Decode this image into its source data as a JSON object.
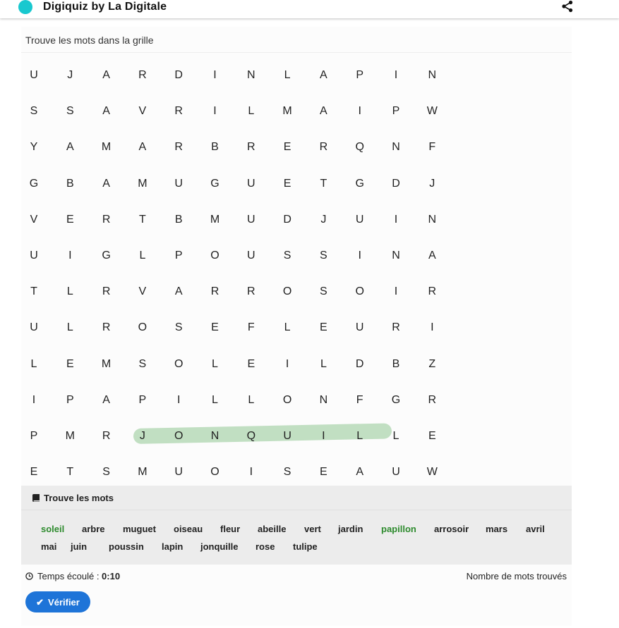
{
  "app": {
    "title": "Digiquiz by La Digitale"
  },
  "prompt": "Trouve les mots dans la grille",
  "grid": [
    [
      "U",
      "J",
      "A",
      "R",
      "D",
      "I",
      "N",
      "L",
      "A",
      "P",
      "I",
      "N"
    ],
    [
      "S",
      "S",
      "A",
      "V",
      "R",
      "I",
      "L",
      "M",
      "A",
      "I",
      "P",
      "W"
    ],
    [
      "Y",
      "A",
      "M",
      "A",
      "R",
      "B",
      "R",
      "E",
      "R",
      "Q",
      "N",
      "F"
    ],
    [
      "G",
      "B",
      "A",
      "M",
      "U",
      "G",
      "U",
      "E",
      "T",
      "G",
      "D",
      "J"
    ],
    [
      "V",
      "E",
      "R",
      "T",
      "B",
      "M",
      "U",
      "D",
      "J",
      "U",
      "I",
      "N"
    ],
    [
      "U",
      "I",
      "G",
      "L",
      "P",
      "O",
      "U",
      "S",
      "S",
      "I",
      "N",
      "A"
    ],
    [
      "T",
      "L",
      "R",
      "V",
      "A",
      "R",
      "R",
      "O",
      "S",
      "O",
      "I",
      "R"
    ],
    [
      "U",
      "L",
      "R",
      "O",
      "S",
      "E",
      "F",
      "L",
      "E",
      "U",
      "R",
      "I"
    ],
    [
      "L",
      "E",
      "M",
      "S",
      "O",
      "L",
      "E",
      "I",
      "L",
      "D",
      "B",
      "Z"
    ],
    [
      "I",
      "P",
      "A",
      "P",
      "I",
      "L",
      "L",
      "O",
      "N",
      "F",
      "G",
      "R"
    ],
    [
      "P",
      "M",
      "R",
      "J",
      "O",
      "N",
      "Q",
      "U",
      "I",
      "L",
      "L",
      "E"
    ],
    [
      "E",
      "T",
      "S",
      "M",
      "U",
      "O",
      "I",
      "S",
      "E",
      "A",
      "U",
      "W"
    ]
  ],
  "highlight_colors": {
    "selection": "#a8d3a9",
    "found_word": "#2e8b2e",
    "accent": "#1e74d8",
    "logo": "#18c8cf"
  },
  "words_panel": {
    "header": "Trouve les mots",
    "words": [
      {
        "text": "soleil",
        "found": true
      },
      {
        "text": "arbre",
        "found": false
      },
      {
        "text": "muguet",
        "found": false
      },
      {
        "text": "oiseau",
        "found": false
      },
      {
        "text": "fleur",
        "found": false
      },
      {
        "text": "abeille",
        "found": false
      },
      {
        "text": "vert",
        "found": false
      },
      {
        "text": "jardin",
        "found": false
      },
      {
        "text": "papillon",
        "found": true
      },
      {
        "text": "arrosoir",
        "found": false
      },
      {
        "text": "mars",
        "found": false
      },
      {
        "text": "avril",
        "found": false
      },
      {
        "text": "mai",
        "found": false
      },
      {
        "text": "juin",
        "found": false
      },
      {
        "text": "poussin",
        "found": false
      },
      {
        "text": "lapin",
        "found": false
      },
      {
        "text": "jonquille",
        "found": false
      },
      {
        "text": "rose",
        "found": false
      },
      {
        "text": "tulipe",
        "found": false
      }
    ]
  },
  "status": {
    "timer_label": "Temps écoulé : ",
    "timer_value": "0:10",
    "found_label": "Nombre de mots trouvés"
  },
  "verify_button": {
    "label": "Vérifier"
  }
}
